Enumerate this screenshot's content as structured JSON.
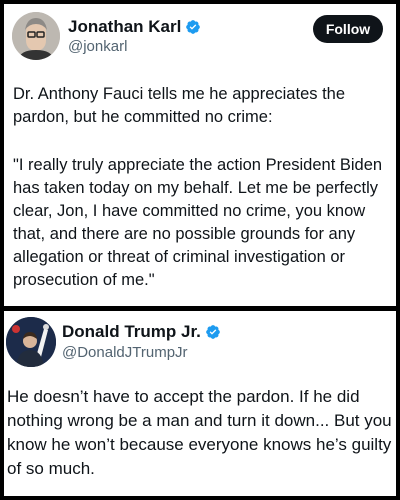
{
  "tweet1": {
    "name": "Jonathan Karl",
    "handle": "@jonkarl",
    "follow_label": "Follow",
    "paragraph1": "Dr. Anthony Fauci tells me he appreciates the pardon, but he committed no crime:",
    "paragraph2": "\"I really truly appreciate the action President Biden has taken today on my behalf.  Let me be perfectly clear, Jon, I have committed no crime, you know that, and there are no possible grounds for any allegation or threat of criminal investigation or prosecution of me.\""
  },
  "tweet2": {
    "name": "Donald Trump Jr.",
    "handle": "@DonaldJTrumpJr",
    "text": "He doesn’t have to accept the pardon. If he did nothing wrong be a man and turn it down... But you know he won’t because everyone knows he’s guilty of so much."
  },
  "colors": {
    "verified_blue": "#1d9bf0",
    "text": "#0f1419",
    "secondary": "#536471",
    "background": "#000000"
  },
  "icons": [
    "verified-badge-icon",
    "avatar"
  ]
}
